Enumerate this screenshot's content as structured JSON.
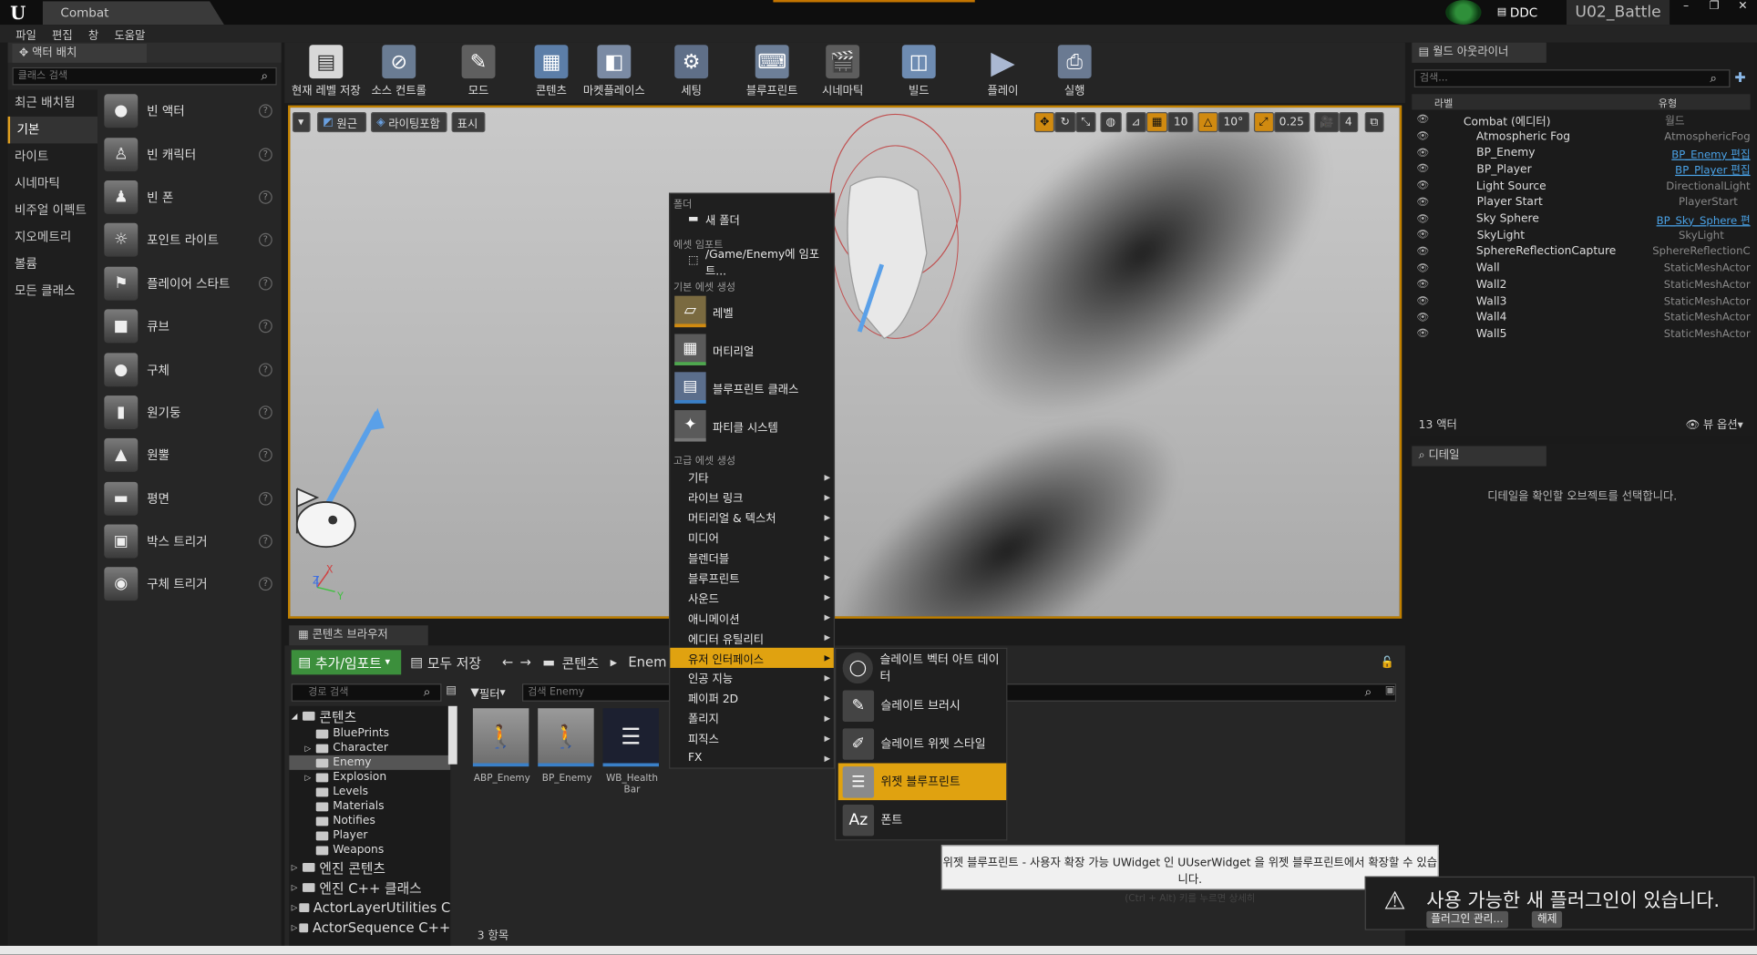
{
  "window": {
    "tab": "Combat",
    "ddc": "DDC",
    "project": "U02_Battle",
    "buttons": [
      "–",
      "❐",
      "✕"
    ]
  },
  "menubar": [
    "파일",
    "편집",
    "창",
    "도움말"
  ],
  "place_actors": {
    "tab": "액터 배치",
    "search_placeholder": "클래스 검색",
    "categories": [
      "최근 배치됨",
      "기본",
      "라이트",
      "시네마틱",
      "비주얼 이펙트",
      "지오메트리",
      "볼륨",
      "모든 클래스"
    ],
    "active_category": "기본",
    "items": [
      "빈 액터",
      "빈 캐릭터",
      "빈 폰",
      "포인트 라이트",
      "플레이어 스타트",
      "큐브",
      "구체",
      "원기둥",
      "원뿔",
      "평면",
      "박스 트리거",
      "구체 트리거"
    ]
  },
  "toolbar": [
    "현재 레벨 저장",
    "소스 컨트롤",
    "모드",
    "콘텐츠",
    "마켓플레이스",
    "세팅",
    "블루프린트",
    "시네마틱",
    "빌드",
    "플레이",
    "실행"
  ],
  "viewport": {
    "left_buttons": [
      "원근",
      "라이팅포함",
      "표시"
    ],
    "grid_snap": "10",
    "rot_snap": "10°",
    "scale_snap": "0.25",
    "cam_speed": "4",
    "axis_x": "X",
    "axis_y": "Y",
    "axis_z": "Z"
  },
  "outliner": {
    "tab": "월드 아웃라이너",
    "search_placeholder": "검색...",
    "col_label": "라벨",
    "col_type": "유형",
    "rows": [
      {
        "name": "Combat (에디터)",
        "type": "월드",
        "link": false
      },
      {
        "name": "Atmospheric Fog",
        "type": "AtmosphericFog",
        "link": false
      },
      {
        "name": "BP_Enemy",
        "type": "BP_Enemy 편집",
        "link": true
      },
      {
        "name": "BP_Player",
        "type": "BP_Player 편집",
        "link": true
      },
      {
        "name": "Light Source",
        "type": "DirectionalLight",
        "link": false
      },
      {
        "name": "Player Start",
        "type": "PlayerStart",
        "link": false
      },
      {
        "name": "Sky Sphere",
        "type": "BP_Sky_Sphere 편",
        "link": true
      },
      {
        "name": "SkyLight",
        "type": "SkyLight",
        "link": false
      },
      {
        "name": "SphereReflectionCapture",
        "type": "SphereReflectionC",
        "link": false
      },
      {
        "name": "Wall",
        "type": "StaticMeshActor",
        "link": false
      },
      {
        "name": "Wall2",
        "type": "StaticMeshActor",
        "link": false
      },
      {
        "name": "Wall3",
        "type": "StaticMeshActor",
        "link": false
      },
      {
        "name": "Wall4",
        "type": "StaticMeshActor",
        "link": false
      },
      {
        "name": "Wall5",
        "type": "StaticMeshActor",
        "link": false
      }
    ],
    "count": "13 액터",
    "view_options": "뷰 옵션"
  },
  "details": {
    "tab": "디테일",
    "message": "디테일을 확인할 오브젝트를 선택합니다."
  },
  "content_browser": {
    "tab": "콘텐츠 브라우저",
    "add_import": "추가/임포트",
    "save_all": "모두 저장",
    "crumb_root": "콘텐츠",
    "crumb_current": "Enem",
    "path_search_placeholder": "경로 검색",
    "filter": "필터",
    "asset_search_placeholder": "검색 Enemy",
    "tree": [
      {
        "label": "콘텐츠",
        "indent": 0,
        "big": true,
        "sel": false,
        "arrow": "◢"
      },
      {
        "label": "BluePrints",
        "indent": 1,
        "big": false,
        "sel": false,
        "arrow": ""
      },
      {
        "label": "Character",
        "indent": 1,
        "big": false,
        "sel": false,
        "arrow": "▷"
      },
      {
        "label": "Enemy",
        "indent": 1,
        "big": false,
        "sel": true,
        "arrow": ""
      },
      {
        "label": "Explosion",
        "indent": 1,
        "big": false,
        "sel": false,
        "arrow": "▷"
      },
      {
        "label": "Levels",
        "indent": 1,
        "big": false,
        "sel": false,
        "arrow": ""
      },
      {
        "label": "Materials",
        "indent": 1,
        "big": false,
        "sel": false,
        "arrow": ""
      },
      {
        "label": "Notifies",
        "indent": 1,
        "big": false,
        "sel": false,
        "arrow": ""
      },
      {
        "label": "Player",
        "indent": 1,
        "big": false,
        "sel": false,
        "arrow": ""
      },
      {
        "label": "Weapons",
        "indent": 1,
        "big": false,
        "sel": false,
        "arrow": ""
      },
      {
        "label": "엔진 콘텐츠",
        "indent": 0,
        "big": true,
        "sel": false,
        "arrow": "▷"
      },
      {
        "label": "엔진 C++ 클래스",
        "indent": 0,
        "big": true,
        "sel": false,
        "arrow": "▷"
      },
      {
        "label": "ActorLayerUtilities C",
        "indent": 0,
        "big": true,
        "sel": false,
        "arrow": "▷"
      },
      {
        "label": "ActorSequence C++",
        "indent": 0,
        "big": true,
        "sel": false,
        "arrow": "▷"
      }
    ],
    "assets": [
      "ABP_Enemy",
      "BP_Enemy",
      "WB_Health Bar"
    ],
    "item_count": "3 항목"
  },
  "context_menu": {
    "sec_folder": "폴더",
    "new_folder": "새 폴더",
    "sec_import": "에셋 임포트",
    "import_to": "/Game/Enemy에 임포트...",
    "sec_basic": "기본 에셋 생성",
    "basic": [
      "레벨",
      "머티리얼",
      "블루프린트 클래스",
      "파티클 시스템"
    ],
    "sec_advanced": "고급 에셋 생성",
    "advanced": [
      "기타",
      "라이브 링크",
      "머티리얼 & 텍스처",
      "미디어",
      "블렌더블",
      "블루프린트",
      "사운드",
      "애니메이션",
      "에디터 유틸리티",
      "유저 인터페이스",
      "인공 지능",
      "페이퍼 2D",
      "폴리지",
      "피직스",
      "FX"
    ],
    "highlighted": "유저 인터페이스"
  },
  "submenu": {
    "items": [
      "슬레이트 벡터 아트 데이터",
      "슬레이트 브러시",
      "슬레이트 위젯 스타일",
      "위젯 블루프린트",
      "폰트"
    ],
    "highlighted": "위젯 블루프린트"
  },
  "tooltip": {
    "main": "위젯 블루프린트 - 사용자 확장 가능 UWidget 인 UUserWidget 을 위젯 블루프린트에서 확장할 수 있습니다.",
    "sub": "(Ctrl + Alt) 키를 누르면 상세히"
  },
  "notification": {
    "text": "사용 가능한 새 플러그인이 있습니다.",
    "manage": "플러그인 관리...",
    "dismiss": "해제"
  },
  "colors": {
    "accent": "#e0a210",
    "add_green": "#3c8f3c",
    "link_blue": "#4aa3e8"
  }
}
